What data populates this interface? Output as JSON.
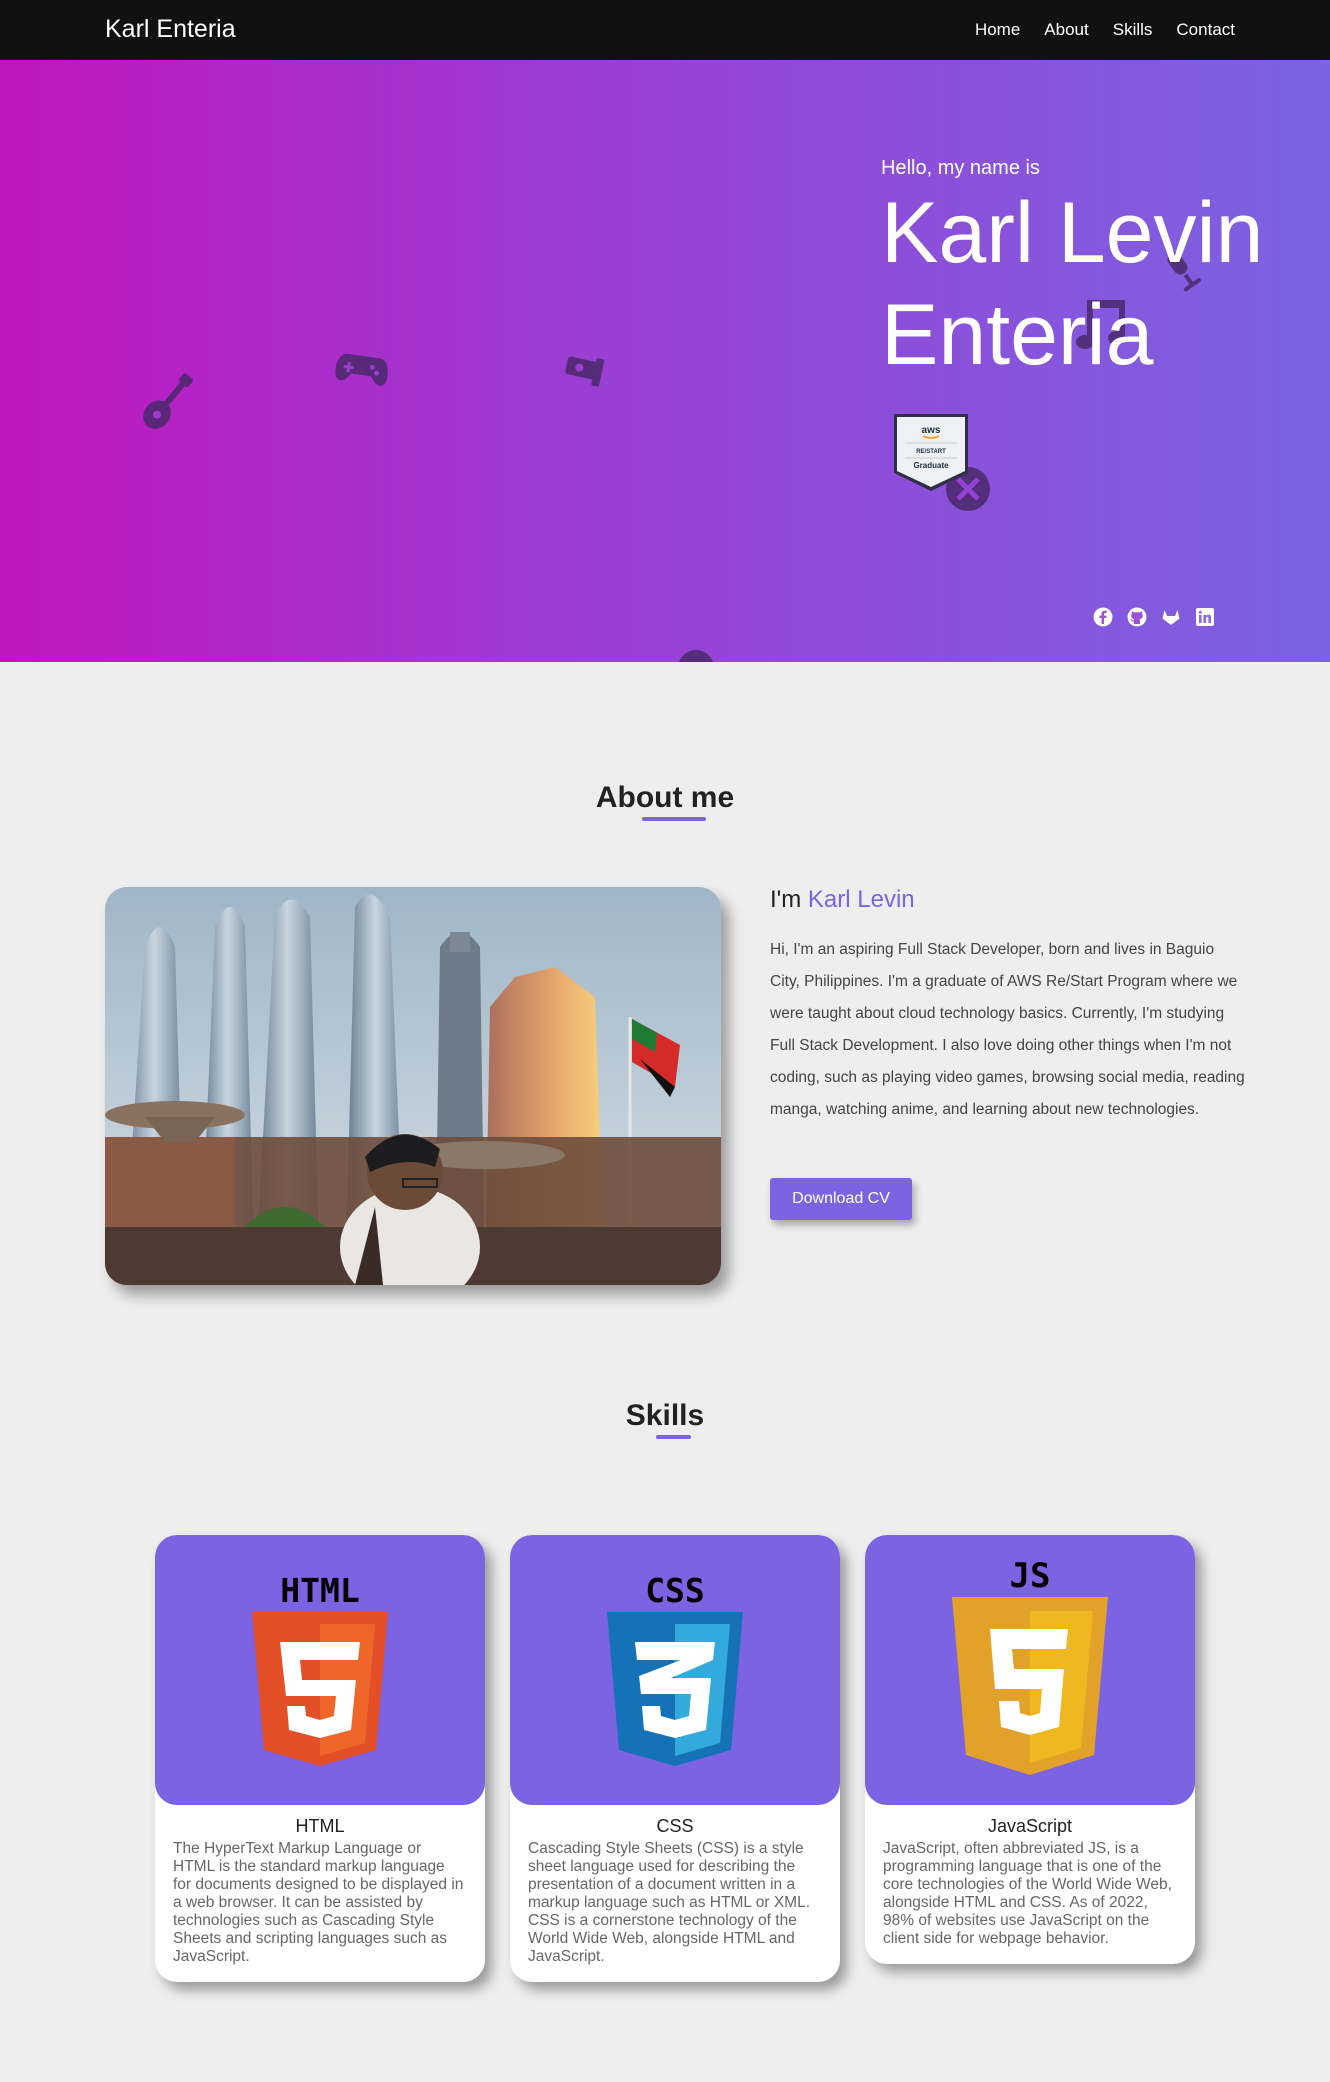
{
  "navbar": {
    "brand": "Karl Enteria",
    "links": [
      "Home",
      "About",
      "Skills",
      "Contact"
    ]
  },
  "hero": {
    "greeting": "Hello, my name is",
    "name": "Karl Levin Enteria",
    "badge": {
      "brand": "aws",
      "program": "RE/START",
      "title": "Graduate"
    },
    "social_icons": [
      "facebook-icon",
      "github-icon",
      "gitlab-icon",
      "linkedin-icon"
    ],
    "colors": {
      "gradient_start": "#bf16be",
      "gradient_end": "#7b63e2"
    }
  },
  "about": {
    "title": "About me",
    "heading_prefix": "I'm",
    "heading_name": "Karl Levin",
    "text": "Hi, I'm an aspiring Full Stack Developer, born and lives in Baguio City, Philippines. I'm a graduate of AWS Re/Start Program where we were taught about cloud technology basics. Currently, I'm studying Full Stack Development. I also love doing other things when I'm not coding, such as playing video games, browsing social media, reading manga, watching anime, and learning about new technologies.",
    "cv_button": "Download CV"
  },
  "skills": {
    "title": "Skills",
    "items": [
      {
        "logo_text": "HTML",
        "name": "HTML",
        "desc": "The HyperText Markup Language or HTML is the standard markup language for documents designed to be displayed in a web browser. It can be assisted by technologies such as Cascading Style Sheets and scripting languages such as JavaScript."
      },
      {
        "logo_text": "CSS",
        "name": "CSS",
        "desc": "Cascading Style Sheets (CSS) is a style sheet language used for describing the presentation of a document written in a markup language such as HTML or XML. CSS is a cornerstone technology of the World Wide Web, alongside HTML and JavaScript."
      },
      {
        "logo_text": "JS",
        "name": "JavaScript",
        "desc": "JavaScript, often abbreviated JS, is a programming language that is one of the core technologies of the World Wide Web, alongside HTML and CSS. As of 2022, 98% of websites use JavaScript on the client side for webpage behavior."
      }
    ]
  },
  "colors": {
    "accent": "#7b63e2",
    "navbar": "#111111",
    "page_bg": "#eeeeee"
  }
}
